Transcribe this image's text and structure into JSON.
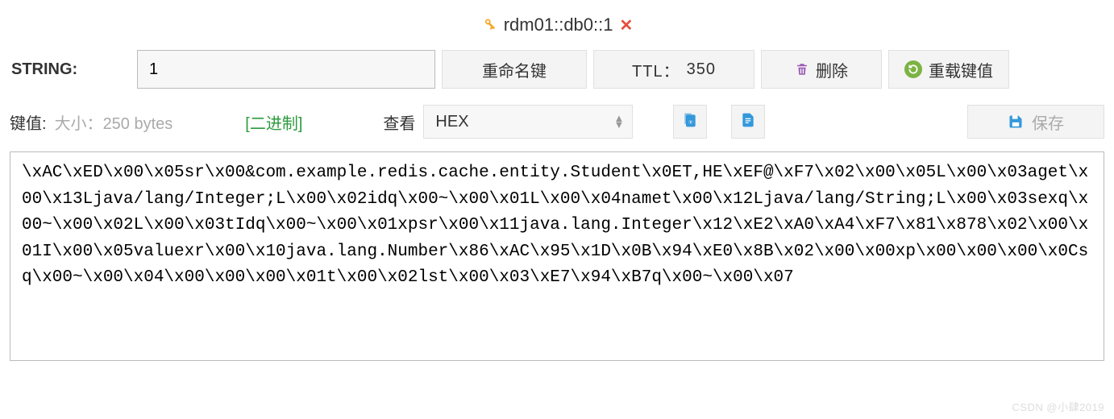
{
  "title": {
    "path": "rdm01::db0::1"
  },
  "toolbar": {
    "type_label": "STRING:",
    "key_name": "1",
    "rename_label": "重命名键",
    "ttl_label": "TTL：",
    "ttl_value": "350",
    "delete_label": "删除",
    "reload_label": "重载键值"
  },
  "value_header": {
    "label": "键值:",
    "size_label": "大小：",
    "size_value": "250 bytes",
    "binary_label": "[二进制]",
    "view_label": "查看",
    "format_selected": "HEX",
    "save_label": "保存"
  },
  "value_content": "\\xAC\\xED\\x00\\x05sr\\x00&com.example.redis.cache.entity.Student\\x0ET,HE\\xEF@\\xF7\\x02\\x00\\x05L\\x00\\x03aget\\x00\\x13Ljava/lang/Integer;L\\x00\\x02idq\\x00~\\x00\\x01L\\x00\\x04namet\\x00\\x12Ljava/lang/String;L\\x00\\x03sexq\\x00~\\x00\\x02L\\x00\\x03tIdq\\x00~\\x00\\x01xpsr\\x00\\x11java.lang.Integer\\x12\\xE2\\xA0\\xA4\\xF7\\x81\\x878\\x02\\x00\\x01I\\x00\\x05valuexr\\x00\\x10java.lang.Number\\x86\\xAC\\x95\\x1D\\x0B\\x94\\xE0\\x8B\\x02\\x00\\x00xp\\x00\\x00\\x00\\x0Csq\\x00~\\x00\\x04\\x00\\x00\\x00\\x01t\\x00\\x02lst\\x00\\x03\\xE7\\x94\\xB7q\\x00~\\x00\\x07",
  "watermark": "CSDN @小肆2019"
}
